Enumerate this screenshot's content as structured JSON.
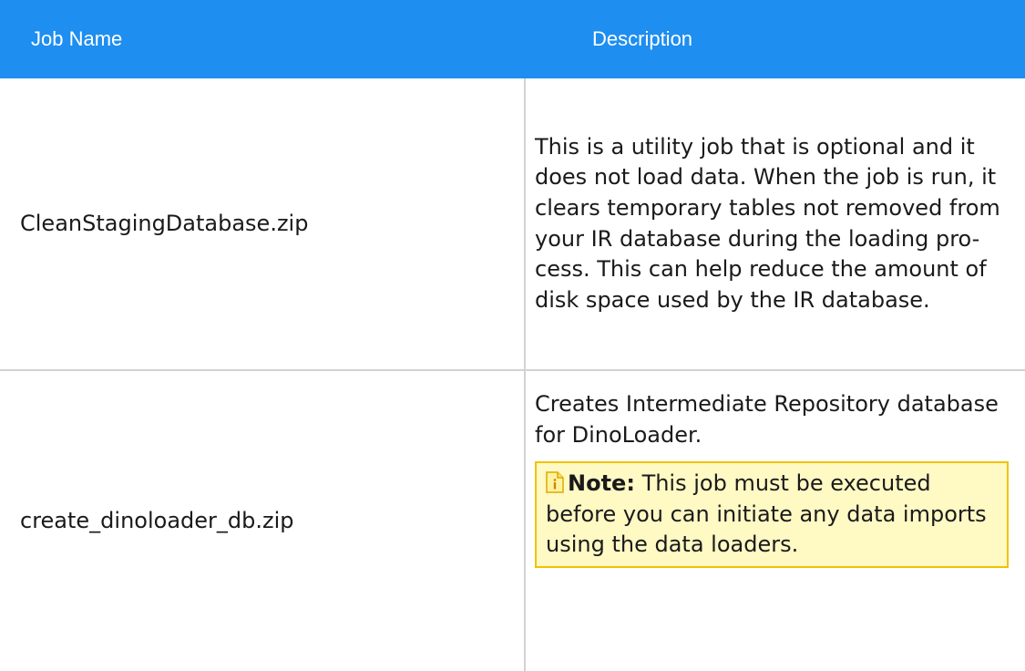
{
  "table": {
    "headers": {
      "job_name": "Job Name",
      "description": "Description"
    },
    "rows": [
      {
        "job_name": "CleanStagingDatabase.zip",
        "description": "This is a utility job that is optional and it does not load data. When the job is run, it clears temporary tables not removed from your IR database during the loading pro-cess. This can help reduce the amount of disk space used by the IR database."
      },
      {
        "job_name": "create_dinoloader_db.zip",
        "description": "Creates Intermediate Repository database for DinoLoader.",
        "note": {
          "icon": "note-icon",
          "label": "Note:",
          "text": "This job must be executed before you can initiate any data imports using the data loaders."
        }
      }
    ]
  },
  "colors": {
    "header_bg": "#1e8ef0",
    "header_text": "#ffffff",
    "note_bg": "#fff9c4",
    "note_border": "#f2c200",
    "grid": "#d2d2d2"
  }
}
